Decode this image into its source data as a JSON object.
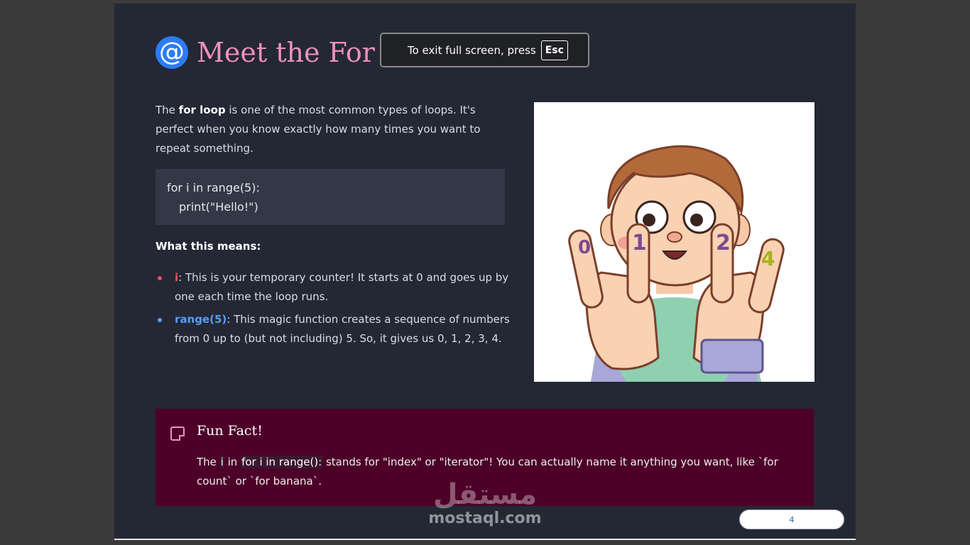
{
  "slide": {
    "title_icon": "cyclone-icon",
    "title": "Meet the For Loop",
    "intro": {
      "before": "The ",
      "bold": "for loop",
      "after": " is one of the most common types of loops. It's perfect when you know exactly how many times you want to repeat something."
    },
    "code": {
      "line1": "for i in range(5):",
      "line2": "print(\"Hello!\")"
    },
    "means_heading": "What this means:",
    "bullets": [
      {
        "key": "i",
        "text": ": This is your temporary counter! It starts at 0 and goes up by one each time the loop runs.",
        "color": "#e8525e"
      },
      {
        "key": "range(5)",
        "text": ": This magic function creates a sequence of numbers from 0 up to (but not including) 5. So, it gives us 0, 1, 2, 3, 4.",
        "color": "#5a9cf0"
      }
    ],
    "illustration": "boy-counting-fingers-illustration",
    "fact": {
      "icon": "sticky-note-icon",
      "title": "Fun Fact!",
      "p1": "The ",
      "code1": "i",
      "p2": " in ",
      "code2": "for i in range():",
      "p3": " stands for \"index\" or \"iterator\"! You can actually name it anything you want, like `for count` or `for banana`."
    }
  },
  "toast": {
    "message": "To exit full screen, press",
    "key": "Esc"
  },
  "watermark": {
    "arabic": "مستقل",
    "latin": "mostaql.com"
  },
  "pager": {
    "page": "4"
  },
  "colors": {
    "title": "#f08fc0",
    "slide_bg": "#232834",
    "fact_bg": "#4d0129"
  }
}
